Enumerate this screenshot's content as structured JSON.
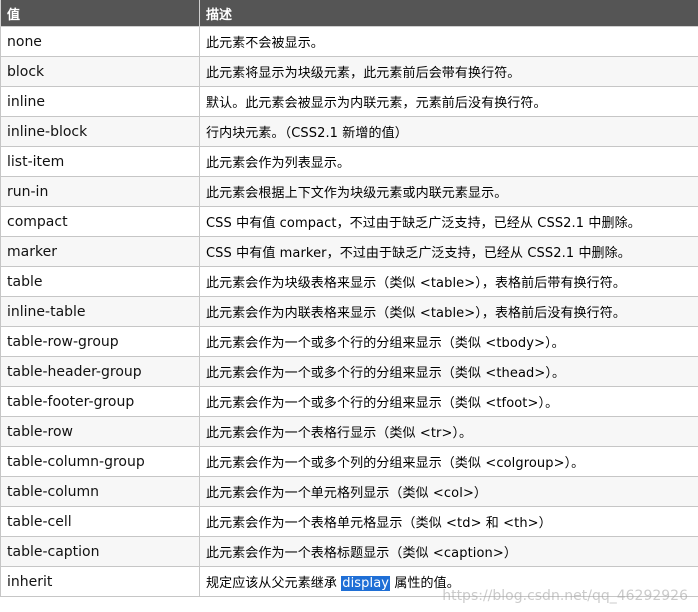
{
  "header": {
    "col_value": "值",
    "col_desc": "描述"
  },
  "rows": [
    {
      "value": "none",
      "desc": "此元素不会被显示。"
    },
    {
      "value": "block",
      "desc": "此元素将显示为块级元素，此元素前后会带有换行符。"
    },
    {
      "value": "inline",
      "desc": "默认。此元素会被显示为内联元素，元素前后没有换行符。"
    },
    {
      "value": "inline-block",
      "desc": "行内块元素。（CSS2.1 新增的值）"
    },
    {
      "value": "list-item",
      "desc": "此元素会作为列表显示。"
    },
    {
      "value": "run-in",
      "desc": "此元素会根据上下文作为块级元素或内联元素显示。"
    },
    {
      "value": "compact",
      "desc": "CSS 中有值 compact，不过由于缺乏广泛支持，已经从 CSS2.1 中删除。"
    },
    {
      "value": "marker",
      "desc": "CSS 中有值 marker，不过由于缺乏广泛支持，已经从 CSS2.1 中删除。"
    },
    {
      "value": "table",
      "desc": "此元素会作为块级表格来显示（类似 <table>），表格前后带有换行符。"
    },
    {
      "value": "inline-table",
      "desc": "此元素会作为内联表格来显示（类似 <table>），表格前后没有换行符。"
    },
    {
      "value": "table-row-group",
      "desc": "此元素会作为一个或多个行的分组来显示（类似 <tbody>）。"
    },
    {
      "value": "table-header-group",
      "desc": "此元素会作为一个或多个行的分组来显示（类似 <thead>）。"
    },
    {
      "value": "table-footer-group",
      "desc": "此元素会作为一个或多个行的分组来显示（类似 <tfoot>）。"
    },
    {
      "value": "table-row",
      "desc": "此元素会作为一个表格行显示（类似 <tr>）。"
    },
    {
      "value": "table-column-group",
      "desc": "此元素会作为一个或多个列的分组来显示（类似 <colgroup>）。"
    },
    {
      "value": "table-column",
      "desc": "此元素会作为一个单元格列显示（类似 <col>）"
    },
    {
      "value": "table-cell",
      "desc": "此元素会作为一个表格单元格显示（类似 <td> 和 <th>）"
    },
    {
      "value": "table-caption",
      "desc": "此元素会作为一个表格标题显示（类似 <caption>）"
    }
  ],
  "last_row": {
    "value": "inherit",
    "desc_before": "规定应该从父元素继承 ",
    "desc_highlight": "display",
    "desc_after": " 属性的值。"
  },
  "watermark": "https://blog.csdn.net/qq_46292926",
  "colors": {
    "header_bg": "#555555",
    "header_text": "#ffffff",
    "highlight_bg": "#1f6fd6"
  }
}
